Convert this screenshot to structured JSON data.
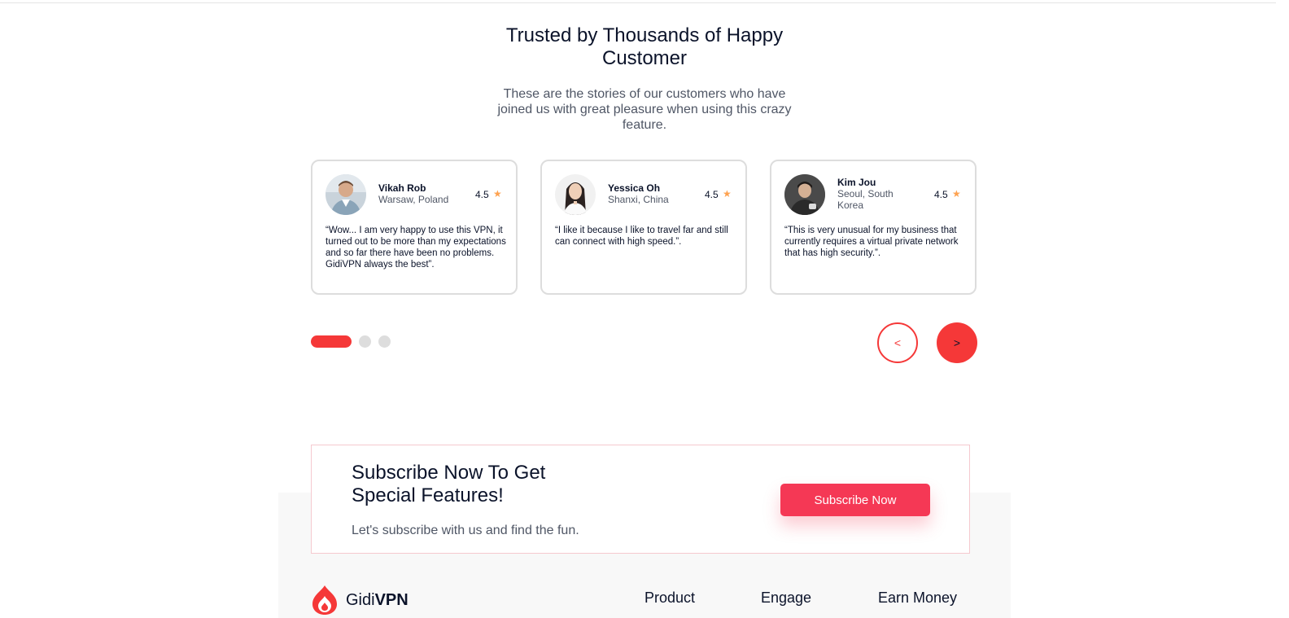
{
  "testimonials": {
    "title": "Trusted by Thousands of Happy Customer",
    "subtitle": "These are the stories of our customers who have joined us with great pleasure when using this crazy feature.",
    "cards": [
      {
        "name": "Vikah Rob",
        "location": "Warsaw, Poland",
        "rating": "4.5",
        "quote": "“Wow... I am very happy to use this VPN, it turned out to be more than my expectations and so far there have been no problems. GidiVPN always the best”."
      },
      {
        "name": "Yessica Oh",
        "location": "Shanxi, China",
        "rating": "4.5",
        "quote": "“I like it because I like to travel far and still can connect with high speed.”."
      },
      {
        "name": "Kim Jou",
        "location": "Seoul, South Korea",
        "rating": "4.5",
        "quote": "“This is very unusual for my business that currently requires a virtual private network that has high security.”."
      }
    ],
    "prev_label": "<",
    "next_label": ">",
    "active_slide": 1,
    "total_slides": 3
  },
  "subscribe": {
    "title": "Subscribe Now To Get Special Features!",
    "text": "Let's subscribe with us and find the fun.",
    "button_label": "Subscribe Now"
  },
  "footer": {
    "logo_light": "Gidi",
    "logo_bold": "VPN",
    "columns": [
      "Product",
      "Engage",
      "Earn Money"
    ]
  },
  "colors": {
    "accent": "#f53838",
    "button": "#f53855",
    "star": "#fea250"
  }
}
